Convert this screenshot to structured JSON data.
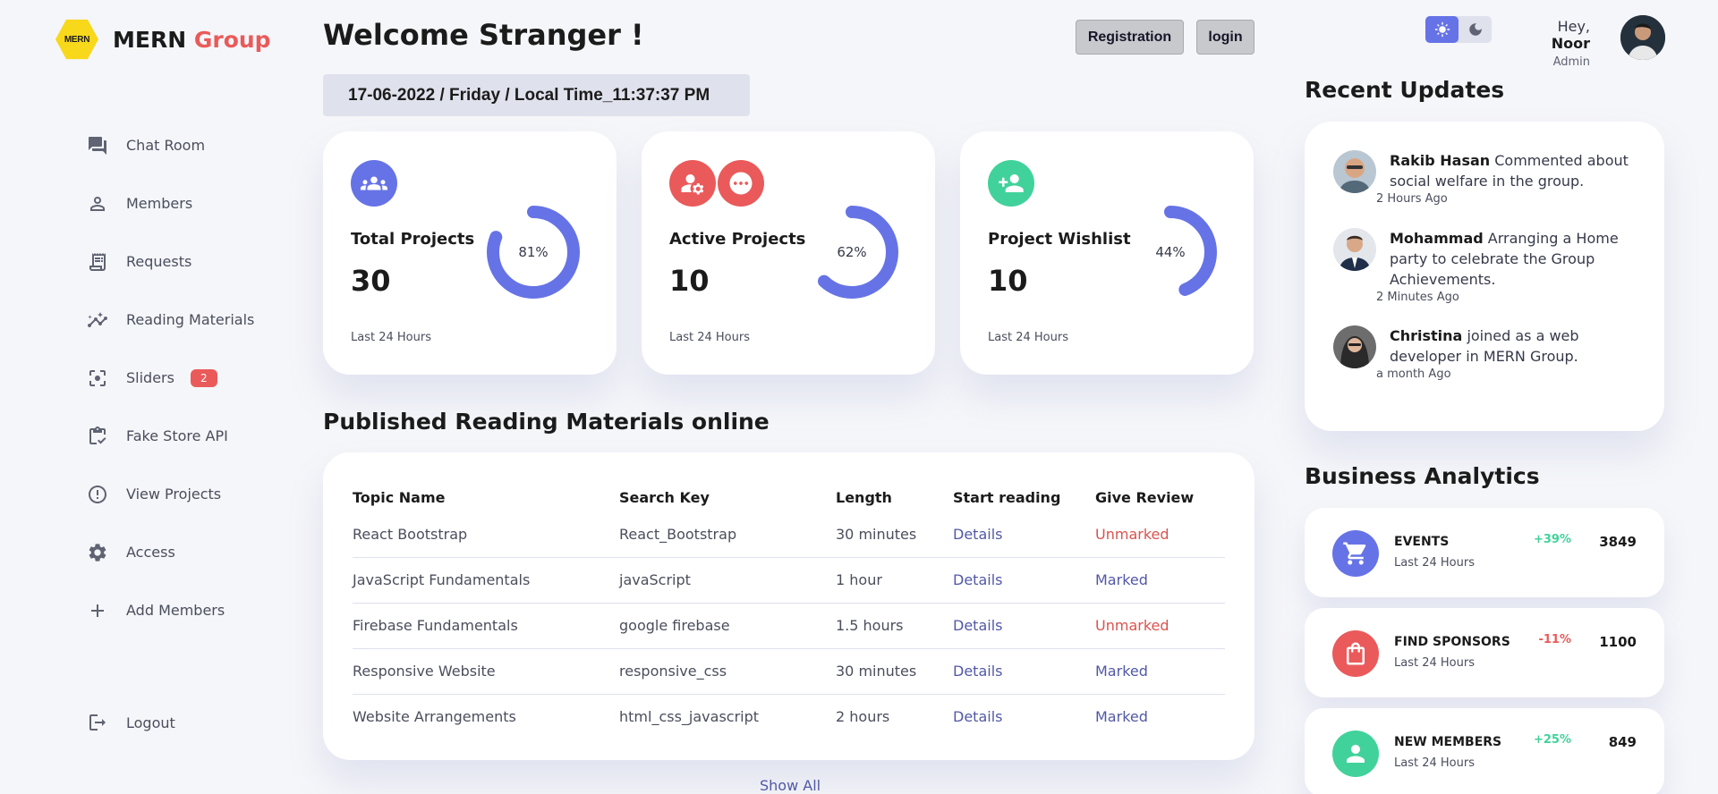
{
  "brand": {
    "logo_text": "MERN",
    "name_main": "MERN",
    "name_accent": "Group"
  },
  "sidebar": {
    "items": [
      {
        "label": "Chat Room",
        "icon": "chat-icon"
      },
      {
        "label": "Members",
        "icon": "person-icon"
      },
      {
        "label": "Requests",
        "icon": "receipt-icon"
      },
      {
        "label": "Reading Materials",
        "icon": "insights-icon"
      },
      {
        "label": "Sliders",
        "icon": "center-focus-icon",
        "badge": "2"
      },
      {
        "label": "Fake Store API",
        "icon": "clipboard-check-icon"
      },
      {
        "label": "View Projects",
        "icon": "error-icon"
      },
      {
        "label": "Access",
        "icon": "gear-icon"
      },
      {
        "label": "Add Members",
        "icon": "plus-icon"
      }
    ],
    "logout": "Logout"
  },
  "header": {
    "welcome": "Welcome Stranger !",
    "registration": "Registration",
    "login": "login",
    "datetime": "17-06-2022 / Friday / Local Time_11:37:37 PM"
  },
  "profile": {
    "hey": "Hey,",
    "name": "Noor",
    "role": "Admin"
  },
  "cards": [
    {
      "title": "Total Projects",
      "count": "30",
      "percent_label": "81%",
      "percent": 0.81,
      "sub": "Last 24 Hours",
      "color": "#6673e6"
    },
    {
      "title": "Active Projects",
      "count": "10",
      "percent_label": "62%",
      "percent": 0.62,
      "sub": "Last 24 Hours",
      "color": "#ea5a5a"
    },
    {
      "title": "Project Wishlist",
      "count": "10",
      "percent_label": "44%",
      "percent": 0.44,
      "sub": "Last 24 Hours",
      "color": "#41d29b"
    }
  ],
  "materials": {
    "title": "Published Reading Materials online",
    "headers": [
      "Topic Name",
      "Search Key",
      "Length",
      "Start reading",
      "Give Review"
    ],
    "rows": [
      {
        "topic": "React Bootstrap",
        "key": "React_Bootstrap",
        "length": "30 minutes",
        "start": "Details",
        "review": "Unmarked"
      },
      {
        "topic": "JavaScript Fundamentals",
        "key": "javaScript",
        "length": "1 hour",
        "start": "Details",
        "review": "Marked"
      },
      {
        "topic": "Firebase Fundamentals",
        "key": "google firebase",
        "length": "1.5 hours",
        "start": "Details",
        "review": "Unmarked"
      },
      {
        "topic": "Responsive Website",
        "key": "responsive_css",
        "length": "30 minutes",
        "start": "Details",
        "review": "Marked"
      },
      {
        "topic": "Website Arrangements",
        "key": "html_css_javascript",
        "length": "2 hours",
        "start": "Details",
        "review": "Marked"
      }
    ],
    "show_all": "Show All"
  },
  "updates": {
    "title": "Recent Updates",
    "items": [
      {
        "name": "Rakib Hasan",
        "text": " Commented about social welfare in the group.",
        "time": "2 Hours Ago"
      },
      {
        "name": "Mohammad",
        "text": " Arranging a Home party to celebrate the Group Achievements.",
        "time": "2 Minutes Ago"
      },
      {
        "name": "Christina",
        "text": " joined as a web developer in MERN Group.",
        "time": "a month Ago"
      }
    ]
  },
  "analytics": {
    "title": "Business Analytics",
    "items": [
      {
        "name": "EVENTS",
        "sub": "Last 24 Hours",
        "change": "+39%",
        "value": "3849",
        "icon": "cart-icon",
        "color": "#6673e6"
      },
      {
        "name": "FIND SPONSORS",
        "sub": "Last 24 Hours",
        "change": "-11%",
        "value": "1100",
        "icon": "shopping-bag-icon",
        "color": "#ea5a5a"
      },
      {
        "name": "NEW MEMBERS",
        "sub": "Last 24 Hours",
        "change": "+25%",
        "value": "849",
        "icon": "person-icon",
        "color": "#41d29b"
      }
    ]
  }
}
